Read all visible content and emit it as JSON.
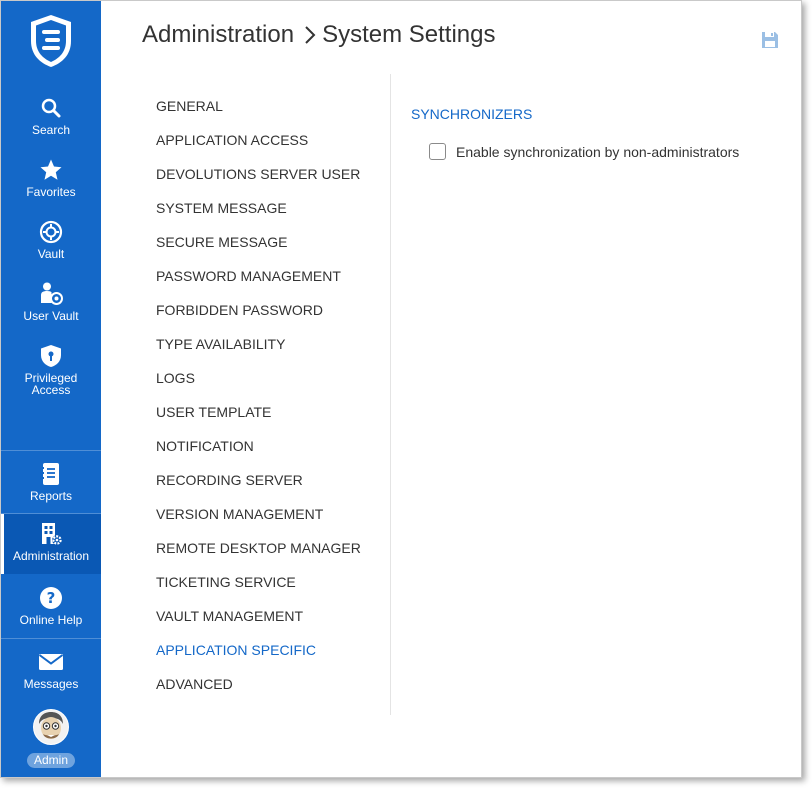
{
  "header": {
    "section": "Administration",
    "page": "System Settings"
  },
  "nav": {
    "top": [
      {
        "id": "search",
        "label": "Search",
        "icon": "search-icon"
      },
      {
        "id": "favorites",
        "label": "Favorites",
        "icon": "star-icon"
      },
      {
        "id": "vault",
        "label": "Vault",
        "icon": "vault-icon"
      },
      {
        "id": "user-vault",
        "label": "User Vault",
        "icon": "user-vault-icon"
      },
      {
        "id": "privileged-access",
        "label": "Privileged Access",
        "icon": "shield-icon"
      }
    ],
    "bottom": [
      {
        "id": "reports",
        "label": "Reports",
        "icon": "reports-icon"
      },
      {
        "id": "administration",
        "label": "Administration",
        "icon": "administration-icon",
        "active": true
      },
      {
        "id": "online-help",
        "label": "Online Help",
        "icon": "help-icon"
      },
      {
        "id": "messages",
        "label": "Messages",
        "icon": "envelope-icon"
      }
    ],
    "user_badge": "Admin"
  },
  "settings_menu": {
    "items": [
      "GENERAL",
      "APPLICATION ACCESS",
      "DEVOLUTIONS SERVER USER",
      "SYSTEM MESSAGE",
      "SECURE MESSAGE",
      "PASSWORD MANAGEMENT",
      "FORBIDDEN PASSWORD",
      "TYPE AVAILABILITY",
      "LOGS",
      "USER TEMPLATE",
      "NOTIFICATION",
      "RECORDING SERVER",
      "VERSION MANAGEMENT",
      "REMOTE DESKTOP MANAGER",
      "TICKETING SERVICE",
      "VAULT MANAGEMENT",
      "APPLICATION SPECIFIC",
      "ADVANCED"
    ],
    "selected": "APPLICATION SPECIFIC"
  },
  "content": {
    "section_title": "SYNCHRONIZERS",
    "options": [
      {
        "label": "Enable synchronization by non-administrators",
        "checked": false
      }
    ]
  },
  "colors": {
    "sidebar": "#1468c8",
    "accent": "#1468c8",
    "active_nav": "#0a58b4",
    "badge": "#6fa3de"
  }
}
